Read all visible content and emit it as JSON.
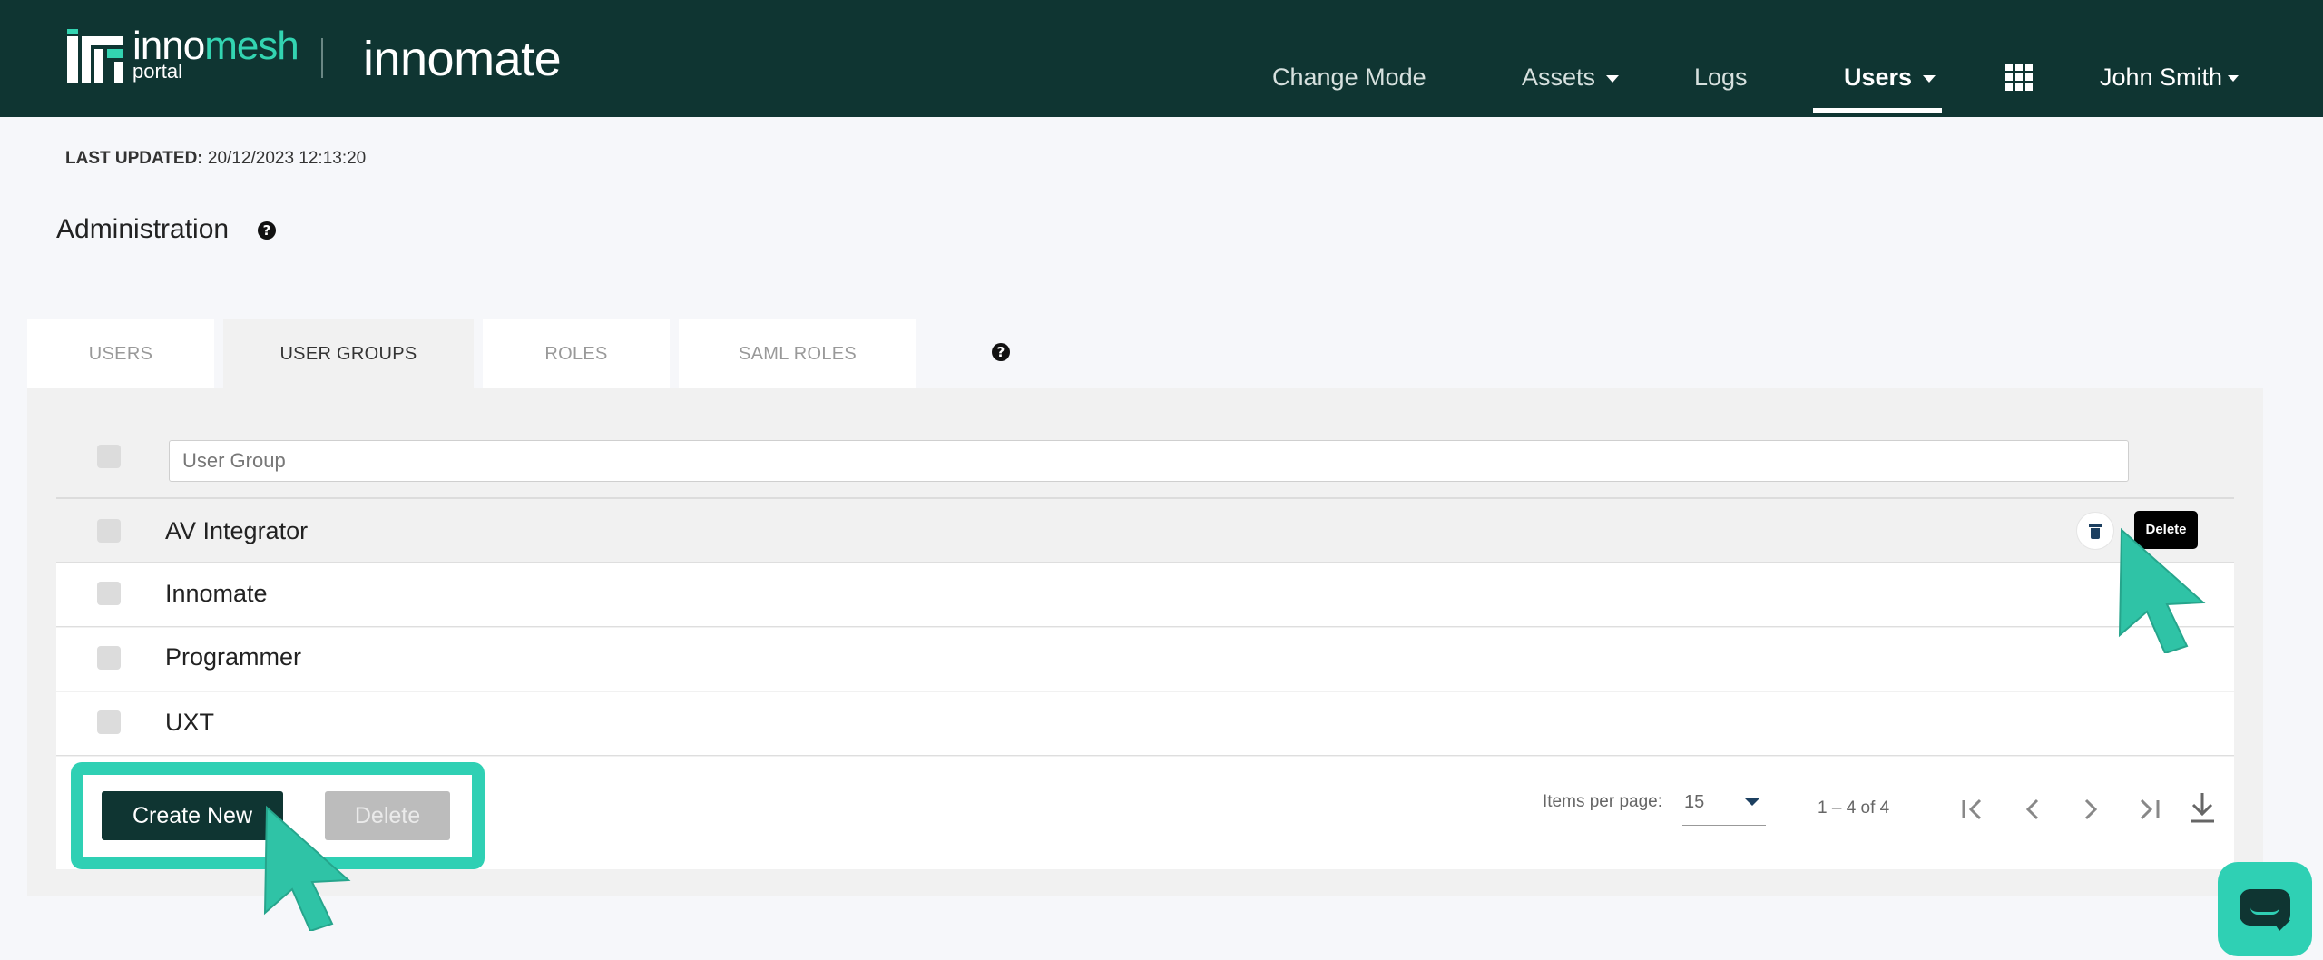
{
  "header": {
    "brand_primary_a": "inno",
    "brand_primary_b": "mesh",
    "brand_primary_sub": "portal",
    "brand_secondary": "innomate",
    "nav": {
      "change_mode": "Change Mode",
      "assets": "Assets",
      "logs": "Logs",
      "users": "Users",
      "user_name": "John Smith"
    },
    "apps_icon": "grid-icon"
  },
  "page": {
    "last_updated_label": "LAST UPDATED:",
    "last_updated_value": "20/12/2023 12:13:20",
    "title": "Administration"
  },
  "tabs": [
    {
      "label": "USERS",
      "active": false
    },
    {
      "label": "USER GROUPS",
      "active": true
    },
    {
      "label": "ROLES",
      "active": false
    },
    {
      "label": "SAML ROLES",
      "active": false
    }
  ],
  "table": {
    "filter_placeholder": "User Group",
    "rows": [
      {
        "name": "AV Integrator"
      },
      {
        "name": "Innomate"
      },
      {
        "name": "Programmer"
      },
      {
        "name": "UXT"
      }
    ],
    "row_action_tooltip": "Delete"
  },
  "actions": {
    "create_new": "Create New",
    "delete": "Delete"
  },
  "pagination": {
    "items_per_page_label": "Items per page:",
    "items_per_page_value": "15",
    "range": "1 – 4 of 4"
  },
  "colors": {
    "header_bg": "#0f3532",
    "accent": "#2fd0b4",
    "brand_accent": "#33d4b1"
  }
}
